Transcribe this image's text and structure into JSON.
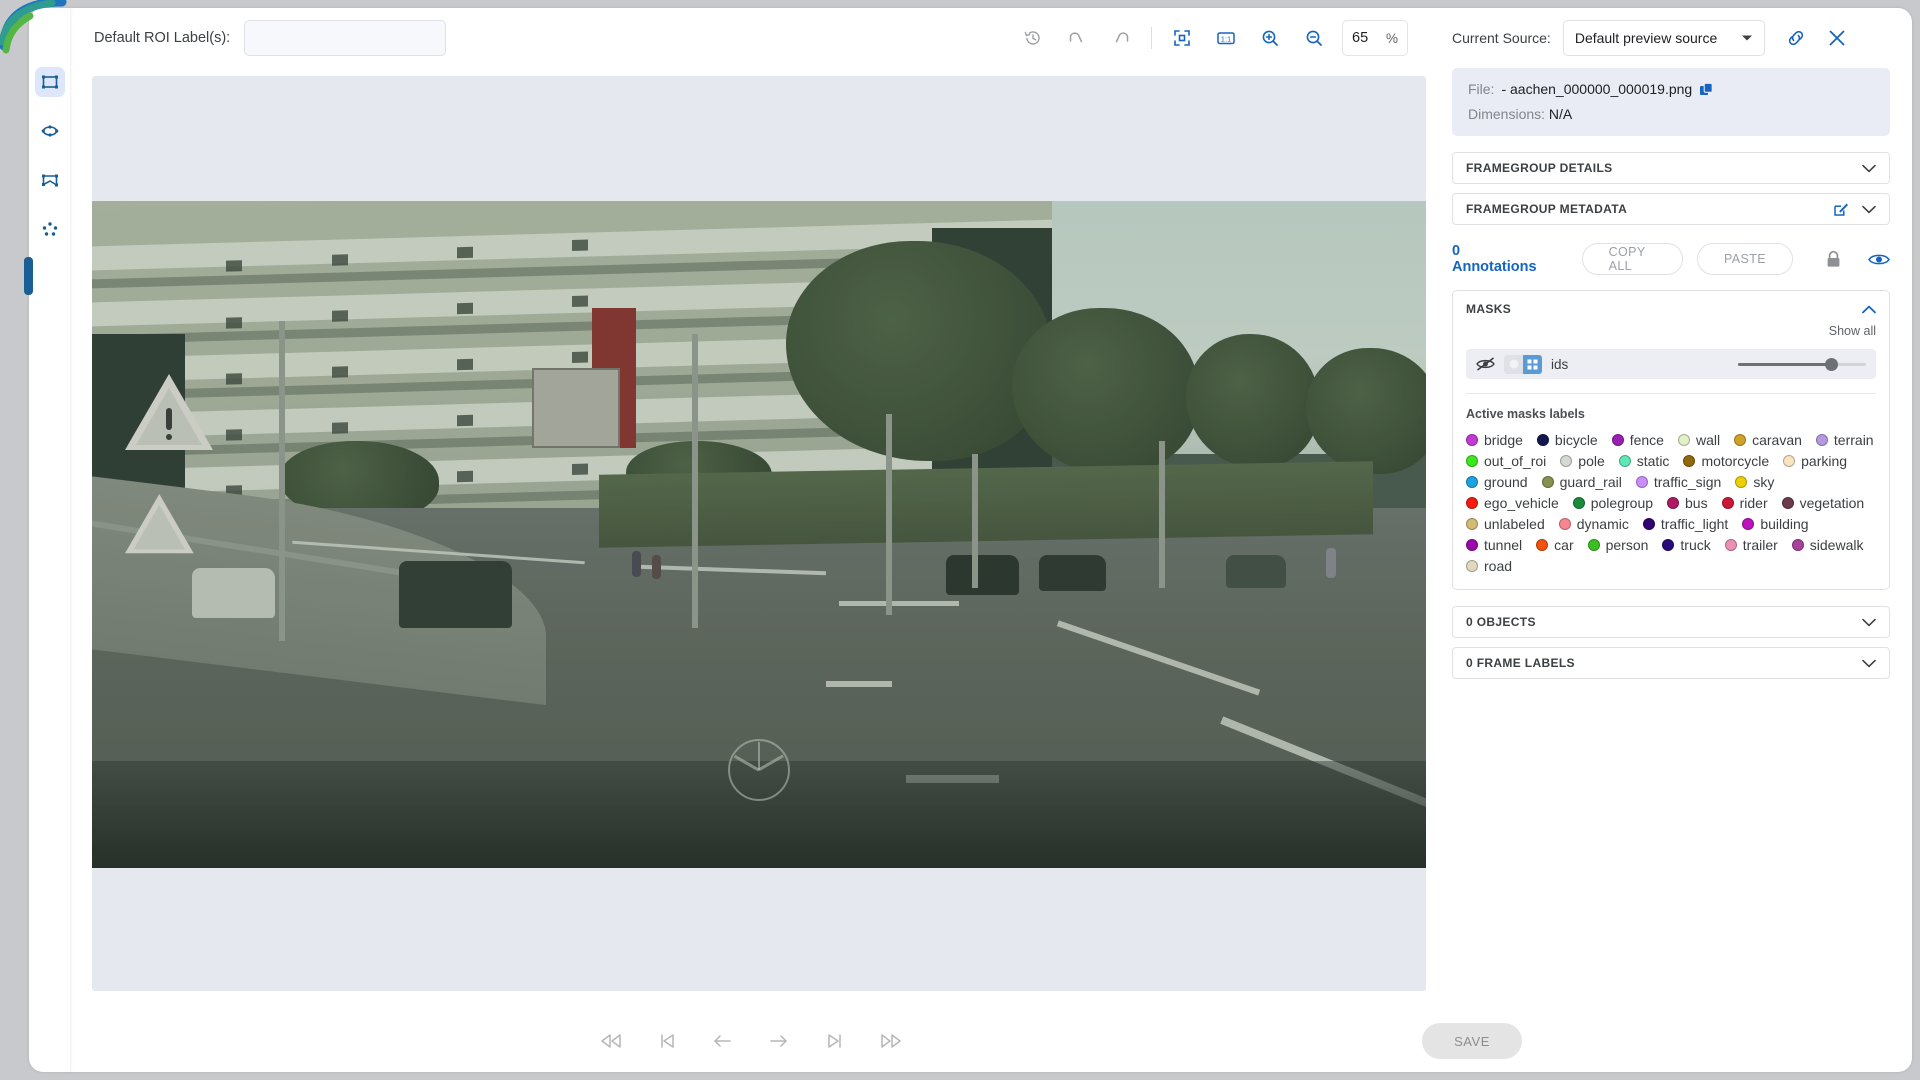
{
  "topbar": {
    "roi_label": "Default ROI Label(s):",
    "roi_value": "",
    "roi_placeholder": "",
    "history_icon": "history-icon",
    "undo_icon": "undo-icon",
    "redo_icon": "redo-icon",
    "fit_icon": "fit-to-screen-icon",
    "actual_size_icon": "one-to-one-icon",
    "zoom_in_icon": "zoom-in-icon",
    "zoom_out_icon": "zoom-out-icon",
    "zoom_value": "65",
    "zoom_unit": "%"
  },
  "source": {
    "label": "Current Source:",
    "selected": "Default preview source",
    "link_icon": "link-icon",
    "close_icon": "close-icon"
  },
  "rail": {
    "items": [
      {
        "name": "bounding-box-tool",
        "active": true
      },
      {
        "name": "ellipse-tool",
        "active": false
      },
      {
        "name": "polygon-tool",
        "active": false
      },
      {
        "name": "keypoints-tool",
        "active": false
      }
    ]
  },
  "file": {
    "file_key": "File:",
    "file_value": "- aachen_000000_000019.png",
    "copy_icon": "copy-icon",
    "dimensions_key": "Dimensions:",
    "dimensions_value": "N/A"
  },
  "sections": {
    "framegroup_details": "FRAMEGROUP DETAILS",
    "framegroup_metadata": "FRAMEGROUP METADATA",
    "objects": "0 OBJECTS",
    "frame_labels": "0 FRAME LABELS"
  },
  "annotations": {
    "count_label": "0 Annotations",
    "copy_all": "COPY ALL",
    "paste": "PASTE",
    "lock_icon": "lock-icon",
    "visibility_icon": "eye-icon"
  },
  "masks": {
    "title": "MASKS",
    "show_all": "Show all",
    "item": {
      "hidden_icon": "eye-off-icon",
      "mode_circle_icon": "circle-icon",
      "mode_grid_icon": "grid-icon",
      "name": "ids",
      "opacity_percent": 73
    },
    "active_labels_title": "Active masks labels",
    "labels": [
      {
        "name": "bridge",
        "color": "#c23ad4"
      },
      {
        "name": "bicycle",
        "color": "#12194f"
      },
      {
        "name": "fence",
        "color": "#9b1fb5"
      },
      {
        "name": "wall",
        "color": "#e2f0c6"
      },
      {
        "name": "caravan",
        "color": "#d0a227"
      },
      {
        "name": "terrain",
        "color": "#b59ae0"
      },
      {
        "name": "out_of_roi",
        "color": "#3ae81c"
      },
      {
        "name": "pole",
        "color": "#d4d9d1"
      },
      {
        "name": "static",
        "color": "#5fe8b6"
      },
      {
        "name": "motorcycle",
        "color": "#91690b"
      },
      {
        "name": "parking",
        "color": "#fbe3c2"
      },
      {
        "name": "ground",
        "color": "#1ba2e0"
      },
      {
        "name": "guard_rail",
        "color": "#87904f"
      },
      {
        "name": "traffic_sign",
        "color": "#cb8dfb"
      },
      {
        "name": "sky",
        "color": "#ecd003"
      },
      {
        "name": "ego_vehicle",
        "color": "#f51b0e"
      },
      {
        "name": "polegroup",
        "color": "#1a8b3c"
      },
      {
        "name": "bus",
        "color": "#b01a63"
      },
      {
        "name": "rider",
        "color": "#cd1636"
      },
      {
        "name": "vegetation",
        "color": "#6d3a4c"
      },
      {
        "name": "unlabeled",
        "color": "#d4bb74"
      },
      {
        "name": "dynamic",
        "color": "#f9868f"
      },
      {
        "name": "traffic_light",
        "color": "#320373"
      },
      {
        "name": "building",
        "color": "#bc13bc"
      },
      {
        "name": "tunnel",
        "color": "#9b0ba8"
      },
      {
        "name": "car",
        "color": "#f4520c"
      },
      {
        "name": "person",
        "color": "#3bc022"
      },
      {
        "name": "truck",
        "color": "#2a0b7a"
      },
      {
        "name": "trailer",
        "color": "#ec8fb4"
      },
      {
        "name": "sidewalk",
        "color": "#a8439c"
      },
      {
        "name": "road",
        "color": "#ded9bf"
      }
    ]
  },
  "playback": {
    "items": [
      {
        "name": "rewind-fast-button"
      },
      {
        "name": "skip-to-start-button"
      },
      {
        "name": "previous-frame-button"
      },
      {
        "name": "next-frame-button"
      },
      {
        "name": "skip-to-end-button"
      },
      {
        "name": "forward-fast-button"
      }
    ]
  },
  "footer": {
    "save_label": "SAVE"
  },
  "colors": {
    "accent": "#1565c0",
    "panel_bg": "#e9ecf5",
    "canvas_bg": "#e6e8f0",
    "rail_active": "#dde6fa"
  }
}
